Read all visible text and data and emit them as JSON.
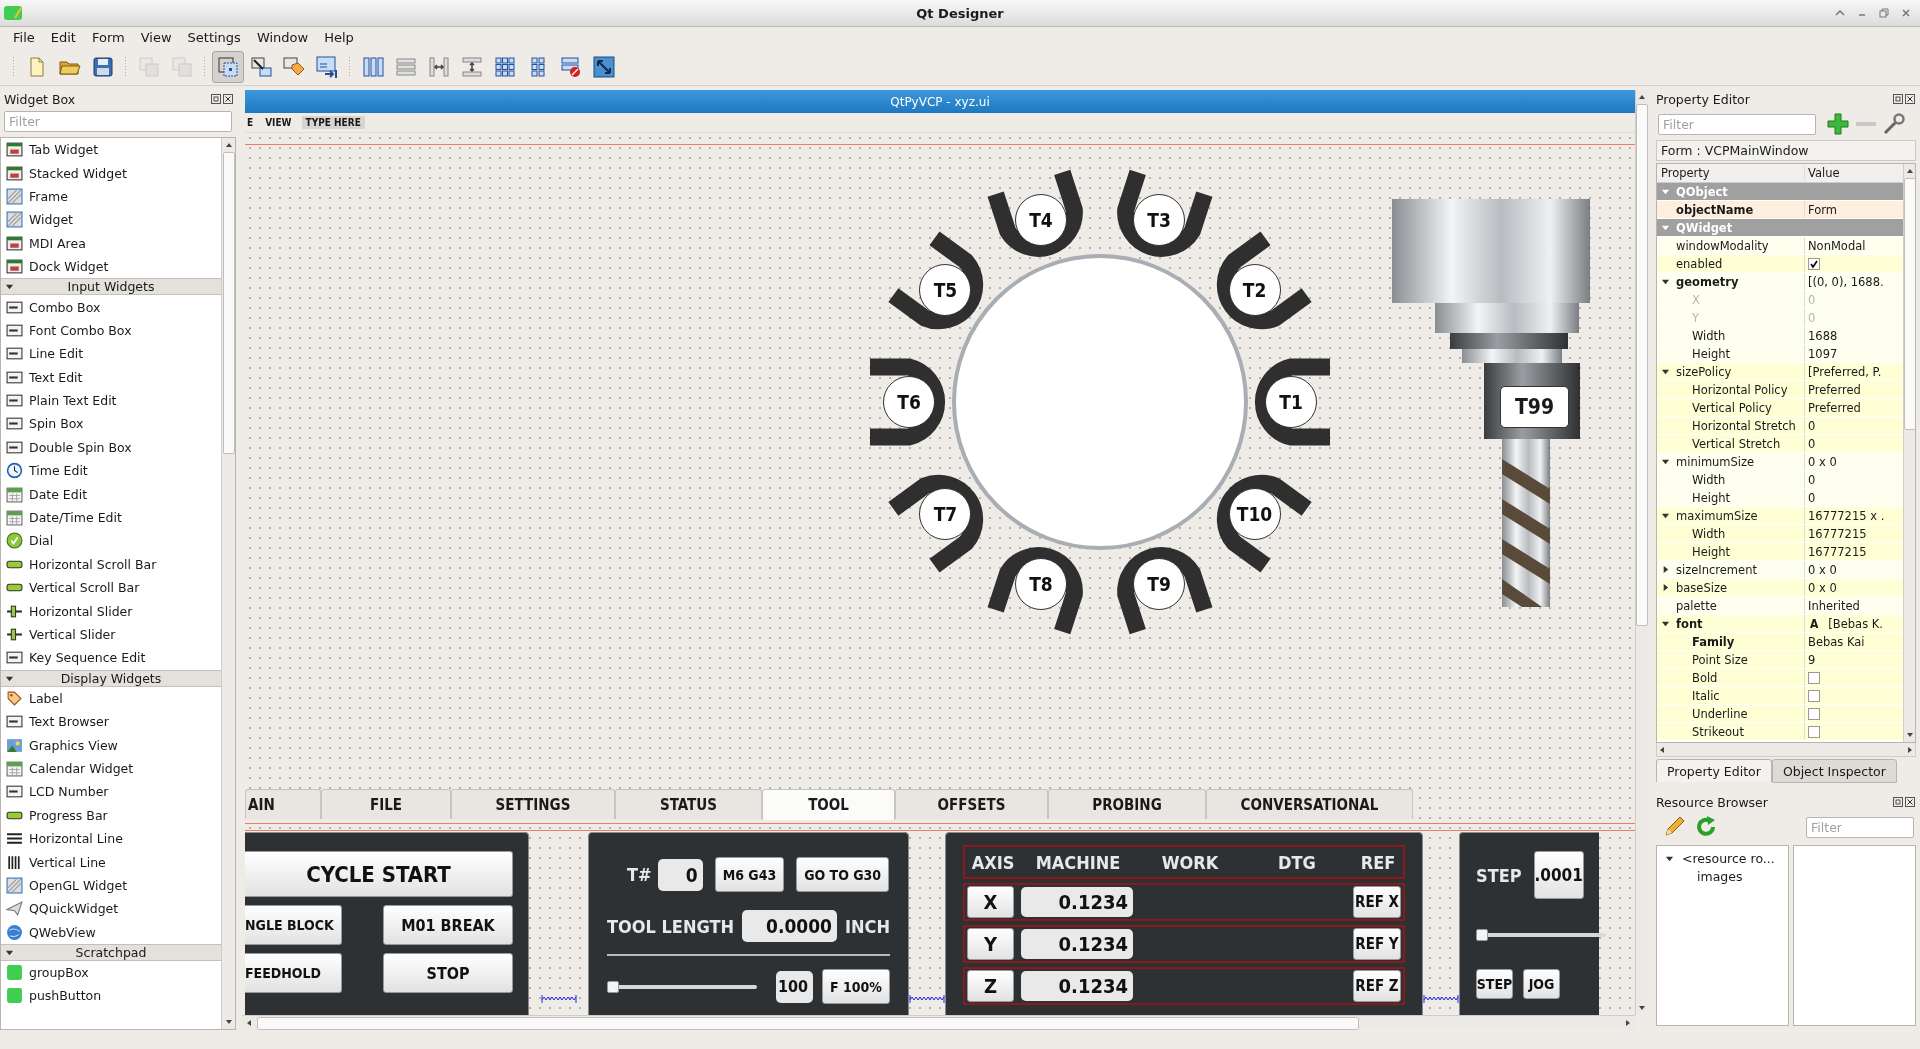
{
  "window": {
    "title": "Qt Designer"
  },
  "menu": [
    {
      "label": "File"
    },
    {
      "label": "Edit"
    },
    {
      "label": "Form"
    },
    {
      "label": "View"
    },
    {
      "label": "Settings"
    },
    {
      "label": "Window"
    },
    {
      "label": "Help"
    }
  ],
  "toolbar": [
    {
      "selected": false,
      "disabled": false
    },
    {
      "selected": false,
      "disabled": false
    },
    {
      "selected": false,
      "disabled": false
    },
    {
      "selected": false,
      "disabled": true
    },
    {
      "selected": false,
      "disabled": true
    },
    {
      "selected": true,
      "disabled": false
    },
    {
      "selected": false,
      "disabled": false
    },
    {
      "selected": false,
      "disabled": false
    },
    {
      "selected": false,
      "disabled": false
    },
    {
      "selected": false,
      "disabled": false
    },
    {
      "selected": false,
      "disabled": false
    },
    {
      "selected": false,
      "disabled": false
    },
    {
      "selected": false,
      "disabled": false
    },
    {
      "selected": false,
      "disabled": false
    },
    {
      "selected": false,
      "disabled": false
    },
    {
      "selected": false,
      "disabled": false
    },
    {
      "selected": false,
      "disabled": false
    }
  ],
  "widget_box": {
    "title": "Widget Box",
    "filter": {
      "placeholder": "Filter"
    },
    "sections": [
      {
        "items": [
          "Tab Widget",
          "Stacked Widget",
          "Frame",
          "Widget",
          "MDI Area",
          "Dock Widget"
        ]
      },
      {
        "title": "Input Widgets",
        "expanded": true,
        "items": [
          "Combo Box",
          "Font Combo Box",
          "Line Edit",
          "Text Edit",
          "Plain Text Edit",
          "Spin Box",
          "Double Spin Box",
          "Time Edit",
          "Date Edit",
          "Date/Time Edit",
          "Dial",
          "Horizontal Scroll Bar",
          "Vertical Scroll Bar",
          "Horizontal Slider",
          "Vertical Slider",
          "Key Sequence Edit"
        ]
      },
      {
        "title": "Display Widgets",
        "expanded": true,
        "items": [
          "Label",
          "Text Browser",
          "Graphics View",
          "Calendar Widget",
          "LCD Number",
          "Progress Bar",
          "Horizontal Line",
          "Vertical Line",
          "OpenGL Widget",
          "QQuickWidget",
          "QWebView"
        ]
      },
      {
        "title": "Scratchpad",
        "expanded": true,
        "items": [
          "groupBox",
          "pushButton"
        ]
      }
    ]
  },
  "form_window": {
    "title": "QtPyVCP - xyz.ui",
    "menu": [
      "E",
      "VIEW"
    ],
    "type_here": "TYPE HERE"
  },
  "tool_changer": {
    "pockets": [
      "T1",
      "T2",
      "T3",
      "T4",
      "T5",
      "T6",
      "T7",
      "T8",
      "T9",
      "T10"
    ]
  },
  "spindle": {
    "tool": "T99"
  },
  "tabs": [
    {
      "label": "AIN",
      "selected": false
    },
    {
      "label": "FILE",
      "selected": false
    },
    {
      "label": "SETTINGS",
      "selected": false
    },
    {
      "label": "STATUS",
      "selected": false
    },
    {
      "label": "TOOL",
      "selected": true
    },
    {
      "label": "OFFSETS",
      "selected": false
    },
    {
      "label": "PROBING",
      "selected": false
    },
    {
      "label": "CONVERSATIONAL",
      "selected": false
    }
  ],
  "cycle_panel": {
    "main": "CYCLE START",
    "buttons": [
      "NGLE BLOCK",
      "M01 BREAK",
      "FEEDHOLD",
      "STOP"
    ]
  },
  "tool_panel": {
    "number_label": "T#",
    "number": "0",
    "buttons": [
      "M6 G43",
      "GO TO G30"
    ],
    "length_label": "TOOL LENGTH",
    "length": "0.0000",
    "unit": "INCH",
    "slider": {
      "level": 0.0
    },
    "feed": "100",
    "feed_button": "F 100%"
  },
  "dro": {
    "columns": [
      "AXIS",
      "MACHINE",
      "WORK",
      "DTG",
      "REF"
    ],
    "rows": [
      {
        "axis": "X",
        "machine": "0.1234",
        "ref": "REF X"
      },
      {
        "axis": "Y",
        "machine": "0.1234",
        "ref": "REF Y"
      },
      {
        "axis": "Z",
        "machine": "0.1234",
        "ref": "REF Z"
      }
    ]
  },
  "jog_panel": {
    "step_label": "STEP",
    "step": ".0001",
    "slider": {
      "level": 0.0
    },
    "buttons": [
      "STEP",
      "JOG"
    ]
  },
  "property_editor": {
    "title": "Property Editor",
    "filter": {
      "placeholder": "Filter"
    },
    "object": "Form : VCPMainWindow",
    "columns": [
      "Property",
      "Value"
    ],
    "groups": [
      {
        "name": "QObject",
        "expanded": true,
        "rows": [
          {
            "name": "objectName",
            "value": "Form",
            "bold": true
          }
        ]
      },
      {
        "name": "QWidget",
        "expanded": true,
        "rows": [
          {
            "name": "windowModality",
            "value": "NonModal",
            "bold": false
          },
          {
            "name": "enabled",
            "kind": "check",
            "checked": true,
            "bold": false
          },
          {
            "name": "geometry",
            "value": "[(0, 0), 1688.",
            "bold": true,
            "expanded": true,
            "children": [
              {
                "name": "X",
                "value": "0",
                "bold": false,
                "disabled": true
              },
              {
                "name": "Y",
                "value": "0",
                "bold": false,
                "disabled": true
              },
              {
                "name": "Width",
                "value": "1688",
                "bold": false,
                "disabled": false
              },
              {
                "name": "Height",
                "value": "1097",
                "bold": false,
                "disabled": false
              }
            ]
          },
          {
            "name": "sizePolicy",
            "value": "[Preferred, P.",
            "bold": false,
            "expanded": true,
            "children": [
              {
                "name": "Horizontal Policy",
                "value": "Preferred",
                "bold": false
              },
              {
                "name": "Vertical Policy",
                "value": "Preferred",
                "bold": false
              },
              {
                "name": "Horizontal Stretch",
                "value": "0",
                "bold": false
              },
              {
                "name": "Vertical Stretch",
                "value": "0",
                "bold": false
              }
            ]
          },
          {
            "name": "minimumSize",
            "value": "0 x 0",
            "bold": false,
            "expanded": true,
            "children": [
              {
                "name": "Width",
                "value": "0",
                "bold": false
              },
              {
                "name": "Height",
                "value": "0",
                "bold": false
              }
            ]
          },
          {
            "name": "maximumSize",
            "value": "16777215 x .",
            "bold": false,
            "expanded": true,
            "children": [
              {
                "name": "Width",
                "value": "16777215",
                "bold": false
              },
              {
                "name": "Height",
                "value": "16777215",
                "bold": false
              }
            ]
          },
          {
            "name": "sizeIncrement",
            "value": "0 x 0",
            "bold": false,
            "expanded": false
          },
          {
            "name": "baseSize",
            "value": "0 x 0",
            "bold": false,
            "expanded": false
          },
          {
            "name": "palette",
            "value": "Inherited",
            "bold": false
          },
          {
            "name": "font",
            "value": "[Bebas K.",
            "preview": "A",
            "bold": true,
            "expanded": true,
            "children": [
              {
                "name": "Family",
                "value": "Bebas Kai",
                "bold": true
              },
              {
                "name": "Point Size",
                "value": "9",
                "bold": false
              },
              {
                "name": "Bold",
                "kind": "check",
                "checked": false,
                "bold": false
              },
              {
                "name": "Italic",
                "kind": "check",
                "checked": false,
                "bold": false
              },
              {
                "name": "Underline",
                "kind": "check",
                "checked": false,
                "bold": false
              },
              {
                "name": "Strikeout",
                "kind": "check",
                "checked": false,
                "bold": false
              }
            ]
          }
        ]
      }
    ]
  },
  "dock_tabs": [
    {
      "label": "Property Editor",
      "selected": true
    },
    {
      "label": "Object Inspector",
      "selected": false
    }
  ],
  "resource_browser": {
    "title": "Resource Browser",
    "filter": {
      "placeholder": "Filter"
    },
    "tree": [
      {
        "label": "<resource ro...",
        "expanded": true,
        "children": [
          {
            "label": "images"
          }
        ]
      }
    ]
  }
}
